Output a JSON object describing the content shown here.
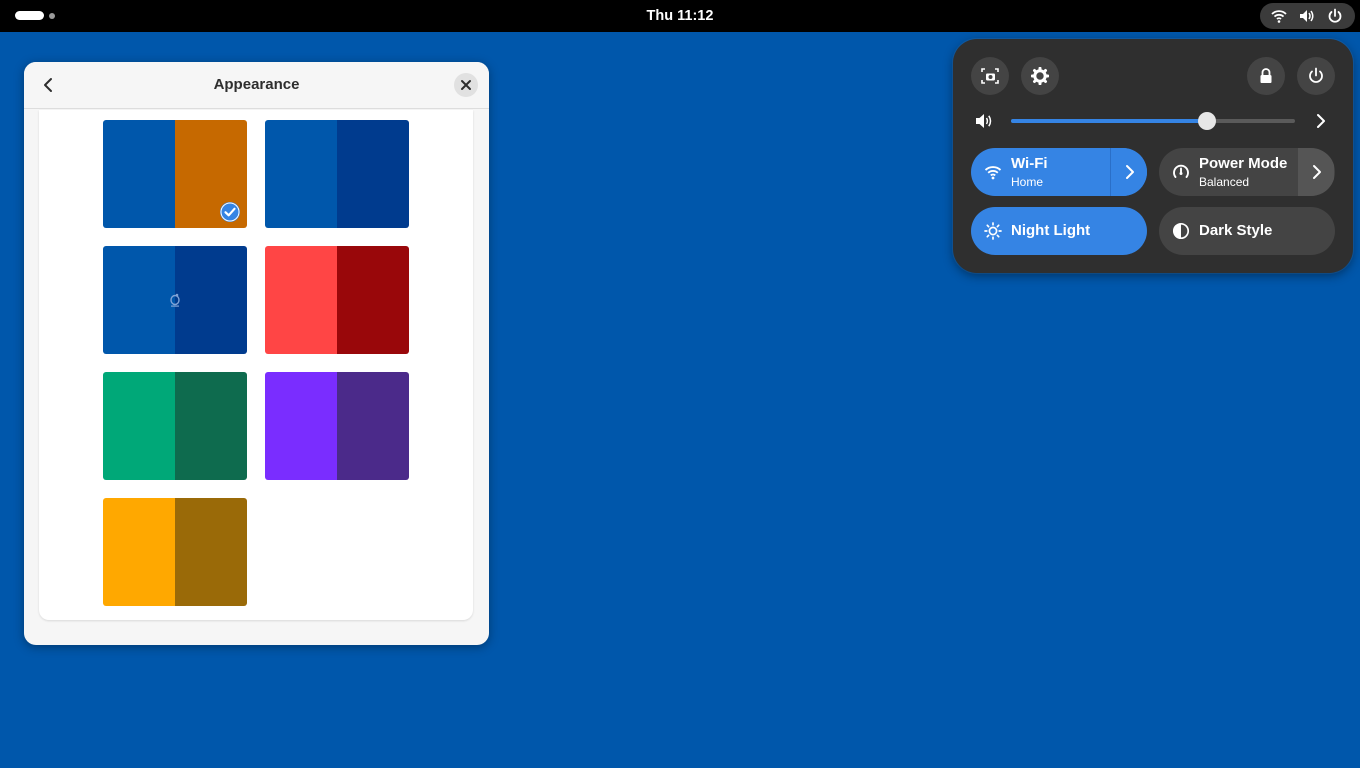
{
  "topbar": {
    "clock": "Thu 11:12",
    "tray_icons": [
      "wifi-icon",
      "speaker-icon",
      "power-icon"
    ]
  },
  "appearance_window": {
    "title": "Appearance",
    "back_icon": "chevron-left-icon",
    "close_icon": "close-icon",
    "wallpapers": [
      {
        "name": "blue-orange",
        "left_color": "#0057ab",
        "right_color": "#c66900",
        "selected": true
      },
      {
        "name": "blue-navy",
        "left_color": "#0057ab",
        "right_color": "#003b8e",
        "selected": false
      },
      {
        "name": "blue-logo",
        "left_color": "#0057ab",
        "right_color": "#003b8e",
        "selected": false
      },
      {
        "name": "red",
        "left_color": "#ff4545",
        "right_color": "#99070a",
        "selected": false
      },
      {
        "name": "green",
        "left_color": "#00a878",
        "right_color": "#0e6b4e",
        "selected": false
      },
      {
        "name": "purple",
        "left_color": "#7a2dff",
        "right_color": "#4b2a8a",
        "selected": false
      },
      {
        "name": "yellow",
        "left_color": "#ffa800",
        "right_color": "#9a6a08",
        "selected": false
      }
    ]
  },
  "quick_settings": {
    "buttons": [
      "screenshot-icon",
      "settings-icon",
      "lock-icon",
      "power-icon"
    ],
    "volume": {
      "level": 0.69,
      "icon": "speaker-icon"
    },
    "tiles": {
      "wifi": {
        "title": "Wi-Fi",
        "subtitle": "Home",
        "active": true
      },
      "power_mode": {
        "title": "Power Mode",
        "subtitle": "Balanced",
        "active": false
      },
      "night_light": {
        "title": "Night Light",
        "active": true
      },
      "dark_style": {
        "title": "Dark Style",
        "active": false
      }
    },
    "colors": {
      "accent": "#3584e4",
      "accent_dark": "#2a6fc8",
      "tile_inactive": "#444444"
    }
  }
}
